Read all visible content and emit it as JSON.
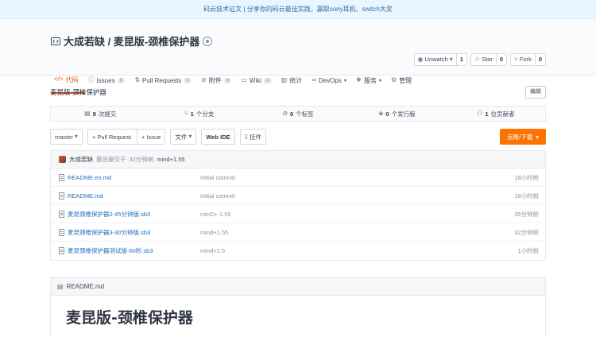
{
  "banner": {
    "text": "码云技术征文 | 分享你的码云最佳实践，赢取sony耳机、switch大奖"
  },
  "repo": {
    "owner": "大成若缺",
    "separator": " / ",
    "name": "麦昆版-颈椎保护器"
  },
  "actions": [
    {
      "label": "Unwatch",
      "count": "1",
      "icon": "eye-icon",
      "caret": "▾"
    },
    {
      "label": "Star",
      "count": "0",
      "icon": "star-icon"
    },
    {
      "label": "Fork",
      "count": "0",
      "icon": "fork-icon"
    }
  ],
  "tabs": [
    {
      "label": "代码",
      "icon": "code-icon"
    },
    {
      "label": "Issues",
      "count": "0",
      "icon": "issue-icon"
    },
    {
      "label": "Pull Requests",
      "count": "0",
      "icon": "pull-request-icon"
    },
    {
      "label": "附件",
      "count": "0",
      "icon": "attachment-icon"
    },
    {
      "label": "Wiki",
      "count": "0",
      "icon": "wiki-icon"
    },
    {
      "label": "统计",
      "icon": "stats-icon"
    },
    {
      "label": "DevOps",
      "icon": "devops-icon",
      "caret": "▾"
    },
    {
      "label": "服务",
      "icon": "service-icon",
      "caret": "▾"
    },
    {
      "label": "管理",
      "icon": "settings-icon"
    }
  ],
  "description": "麦昆版-颈椎保护器",
  "edit_label": "编辑",
  "stats": [
    {
      "value": "9",
      "label": "次提交",
      "icon": "commit-icon"
    },
    {
      "value": "1",
      "label": "个分支",
      "icon": "branch-icon"
    },
    {
      "value": "0",
      "label": "个标签",
      "icon": "tag-icon"
    },
    {
      "value": "0",
      "label": "个发行版",
      "icon": "release-icon"
    },
    {
      "value": "1",
      "label": "位贡献者",
      "icon": "contributor-icon"
    }
  ],
  "toolbar": {
    "branch": "master",
    "pull_request": "+ Pull Request",
    "issue": "+ Issue",
    "file": "文件",
    "web_ide": "Web IDE",
    "widget": "挂件",
    "clone": "克隆/下载"
  },
  "last_commit": {
    "author": "大成若缺",
    "prefix": "最后提交于",
    "time": "32分钟前",
    "message": "mind+1.55"
  },
  "files": [
    {
      "name": "README.en.md",
      "message": "Initial commit",
      "time": "18小时前"
    },
    {
      "name": "README.md",
      "message": "Initial commit",
      "time": "18小时前"
    },
    {
      "name": "麦昆颈椎保护器2-45分钟版.sb3",
      "message": "minD+ 1.55",
      "time": "35分钟前"
    },
    {
      "name": "麦昆颈椎保护器3-30分钟版.sb3",
      "message": "mind+1.55",
      "time": "32分钟前"
    },
    {
      "name": "麦昆颈椎保护器测试版-60秒.sb3",
      "message": "mind+1.5",
      "time": "1小时前"
    }
  ],
  "readme": {
    "filename": "README.md",
    "title": "麦昆版-颈椎保护器"
  }
}
